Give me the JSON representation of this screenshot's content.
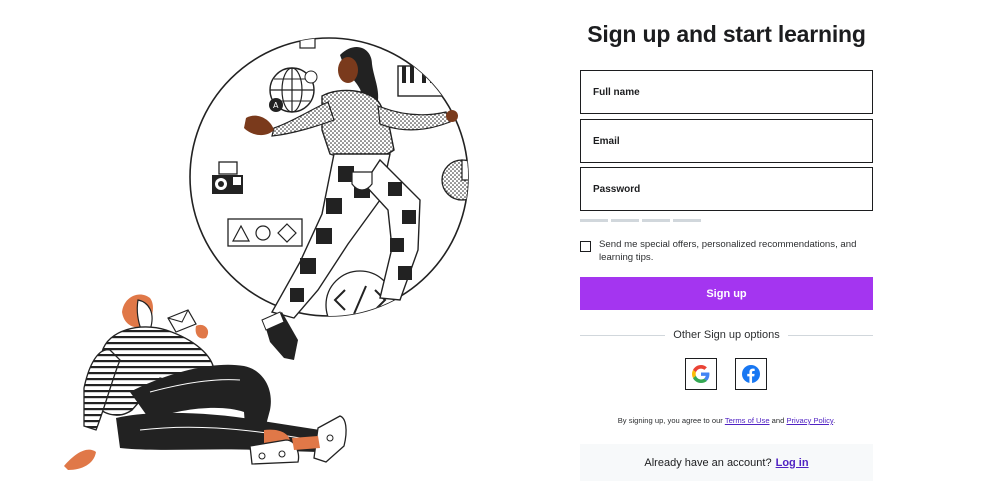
{
  "form": {
    "title": "Sign up and start learning",
    "fields": [
      {
        "placeholder": "Full name"
      },
      {
        "placeholder": "Email"
      },
      {
        "placeholder": "Password"
      }
    ],
    "consent_text": "Send me special offers, personalized recommendations, and learning tips.",
    "signup_label": "Sign up",
    "other_options_label": "Other Sign up options",
    "social": [
      {
        "name": "Google",
        "icon": "google-icon"
      },
      {
        "name": "Facebook",
        "icon": "facebook-icon"
      }
    ],
    "terms_prefix": "By signing up, you agree to our ",
    "terms_link": "Terms of Use",
    "terms_and": " and ",
    "privacy_link": "Privacy Policy",
    "terms_suffix": ".",
    "login_prompt": "Already have an account?",
    "login_link": "Log in"
  },
  "colors": {
    "accent": "#a435f0",
    "link": "#5022c3",
    "text": "#1c1d1f",
    "google_blue": "#4285f4",
    "google_red": "#ea4335",
    "google_yellow": "#fbbc05",
    "google_green": "#34a853",
    "facebook": "#1877f2",
    "skin_orange": "#e07848"
  }
}
